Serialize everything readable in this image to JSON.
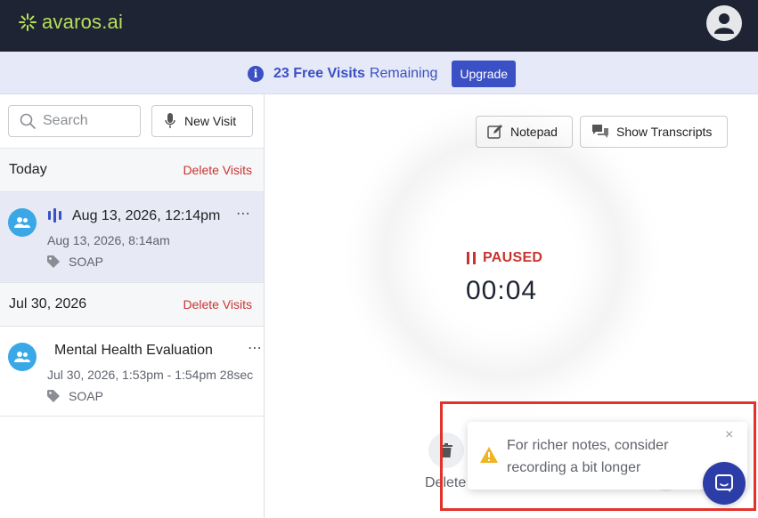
{
  "header": {
    "logo_text": "avaros.ai",
    "brand_color": "#b8e05a",
    "bar_color": "#1e2433",
    "profile_icon": "user-icon"
  },
  "banner": {
    "info_icon": "info-icon",
    "info_glyph": "i",
    "count_text": "23 Free Visits",
    "remaining_text": "Remaining",
    "upgrade_label": "Upgrade",
    "accent_color": "#3b50c4"
  },
  "sidebar": {
    "search_placeholder": "Search",
    "new_visit_label": "New Visit",
    "groups": [
      {
        "title": "Today",
        "delete_label": "Delete Visits",
        "visits": [
          {
            "title": "Aug 13, 2026, 12:14pm",
            "subtitle": "Aug 13, 2026, 8:14am",
            "tag": "SOAP",
            "menu": "⋯",
            "active": true,
            "recording": true
          }
        ]
      },
      {
        "title": "Jul 30, 2026",
        "delete_label": "Delete Visits",
        "visits": [
          {
            "title": "Mental Health Evaluation",
            "subtitle": "Jul 30, 2026, 1:53pm - 1:54pm",
            "duration": "28sec",
            "tag": "SOAP",
            "menu": "⋯",
            "active": false,
            "recording": false
          }
        ]
      }
    ]
  },
  "main": {
    "notepad_label": "Notepad",
    "transcripts_label": "Show Transcripts",
    "status_label": "PAUSED",
    "status_color": "#c8342f",
    "timer": "00:04",
    "delete_label": "Delete"
  },
  "toast": {
    "message": "For richer notes, consider recording a bit longer",
    "warn_icon": "warning-icon",
    "close_glyph": "×",
    "chat_icon": "chat-icon"
  }
}
